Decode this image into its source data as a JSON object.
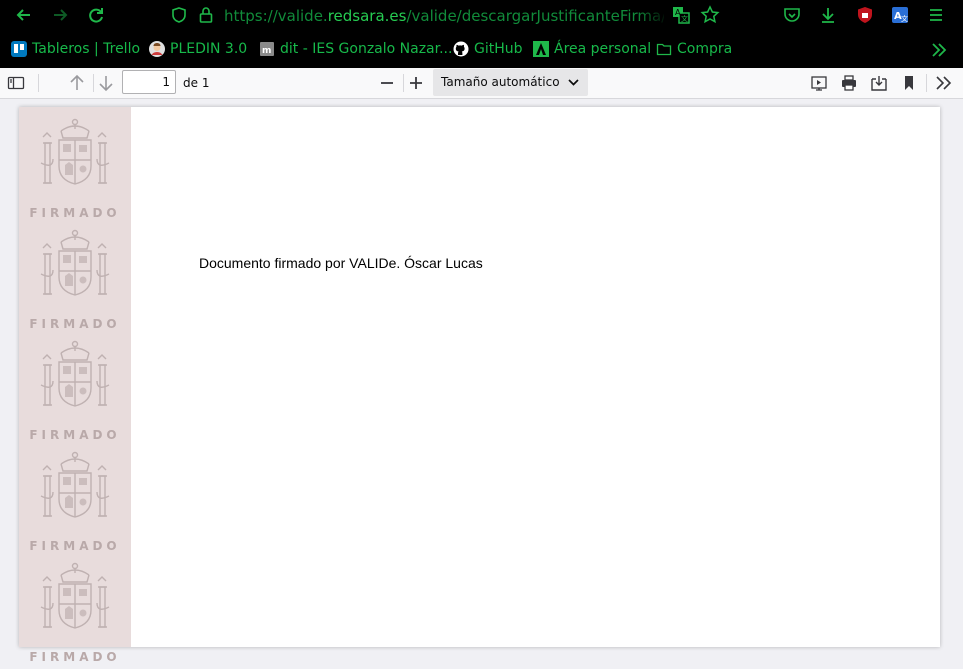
{
  "browser": {
    "url_prefix": "https://valide.",
    "url_host": "redsara.es",
    "url_path": "/valide/descargarJustificanteFirma/ejecu",
    "colors": {
      "accent": "#26cc52",
      "dim_accent": "#118b3a",
      "background": "#000000"
    }
  },
  "bookmarks": [
    {
      "label": "Tableros | Trello",
      "icon": "trello-icon"
    },
    {
      "label": "PLEDIN 3.0",
      "icon": "avatar-icon"
    },
    {
      "label": "dit - IES Gonzalo Nazar...",
      "icon": "moodle-icon"
    },
    {
      "label": "GitHub",
      "icon": "github-icon"
    },
    {
      "label": "Área personal",
      "icon": "andalucia-icon"
    },
    {
      "label": "Compra",
      "icon": "folder-icon"
    }
  ],
  "pdf_toolbar": {
    "page_number": "1",
    "of_pages": "de 1",
    "zoom_label": "Tamaño automático"
  },
  "document": {
    "stamp_label": "FIRMADO",
    "stamp_count": 5,
    "text": "Documento firmado por VALIDe. Óscar Lucas"
  }
}
